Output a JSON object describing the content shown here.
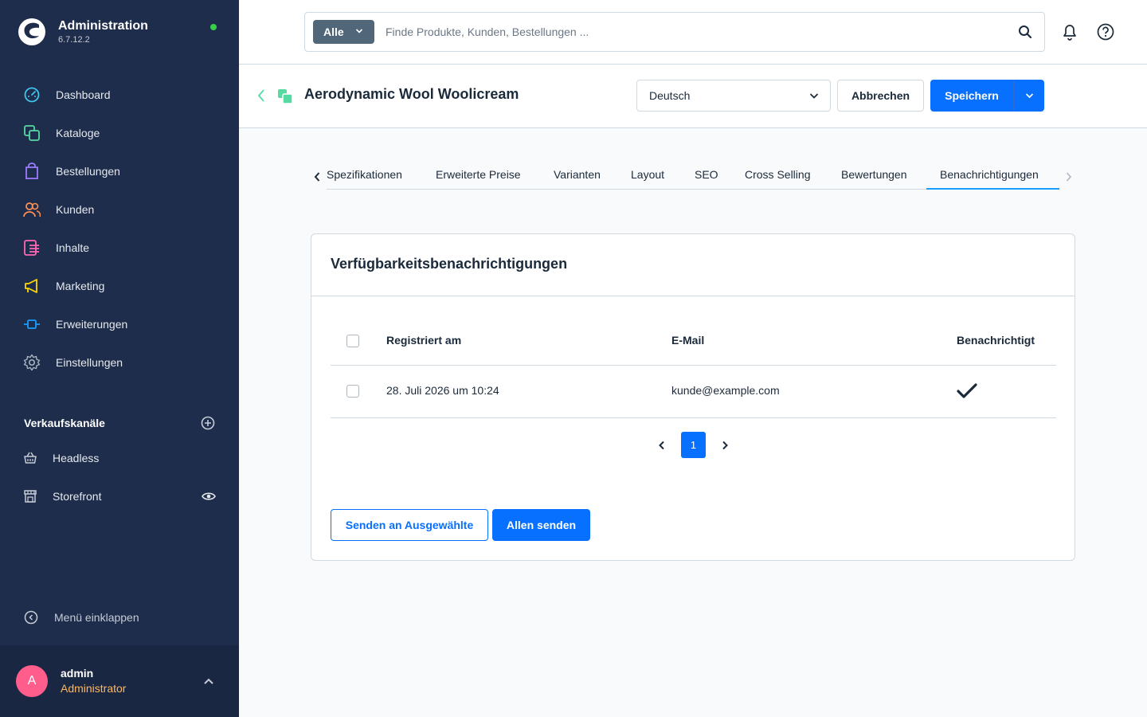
{
  "app": {
    "title": "Administration",
    "version": "6.7.12.2",
    "status_color": "#37d046"
  },
  "sidebar": {
    "items": [
      {
        "label": "Dashboard",
        "icon": "dashboard-icon",
        "color": "#3ec6f0"
      },
      {
        "label": "Kataloge",
        "icon": "catalog-icon",
        "color": "#57d9a3"
      },
      {
        "label": "Bestellungen",
        "icon": "orders-icon",
        "color": "#9c7bff"
      },
      {
        "label": "Kunden",
        "icon": "customers-icon",
        "color": "#ff8f54"
      },
      {
        "label": "Inhalte",
        "icon": "content-icon",
        "color": "#ff68b4"
      },
      {
        "label": "Marketing",
        "icon": "marketing-icon",
        "color": "#ffd700"
      },
      {
        "label": "Erweiterungen",
        "icon": "extensions-icon",
        "color": "#189eff"
      },
      {
        "label": "Einstellungen",
        "icon": "settings-icon",
        "color": "#a8b3bf"
      }
    ],
    "channels_title": "Verkaufskanäle",
    "channels": [
      {
        "label": "Headless",
        "icon": "basket-icon"
      },
      {
        "label": "Storefront",
        "icon": "storefront-icon"
      }
    ],
    "collapse_label": "Menü einklappen",
    "user": {
      "initial": "A",
      "name": "admin",
      "role": "Administrator"
    }
  },
  "topbar": {
    "search_type": "Alle",
    "search_placeholder": "Finde Produkte, Kunden, Bestellungen ..."
  },
  "page": {
    "title": "Aerodynamic Wool Woolicream",
    "language": "Deutsch",
    "cancel_label": "Abbrechen",
    "save_label": "Speichern"
  },
  "tabs": [
    {
      "label": "Spezifikationen"
    },
    {
      "label": "Erweiterte Preise"
    },
    {
      "label": "Varianten"
    },
    {
      "label": "Layout"
    },
    {
      "label": "SEO"
    },
    {
      "label": "Cross Selling"
    },
    {
      "label": "Bewertungen"
    },
    {
      "label": "Benachrichtigungen",
      "active": true
    }
  ],
  "card": {
    "title": "Verfügbarkeitsbenachrichtigungen",
    "columns": [
      "Registriert am",
      "E-Mail",
      "Benachrichtigt"
    ],
    "rows": [
      {
        "registered": "28. Juli 2026 um 10:24",
        "email": "kunde@example.com",
        "notified": true
      }
    ],
    "pagination": {
      "current": "1"
    },
    "send_selected_label": "Senden an Ausgewählte",
    "send_all_label": "Allen senden"
  }
}
